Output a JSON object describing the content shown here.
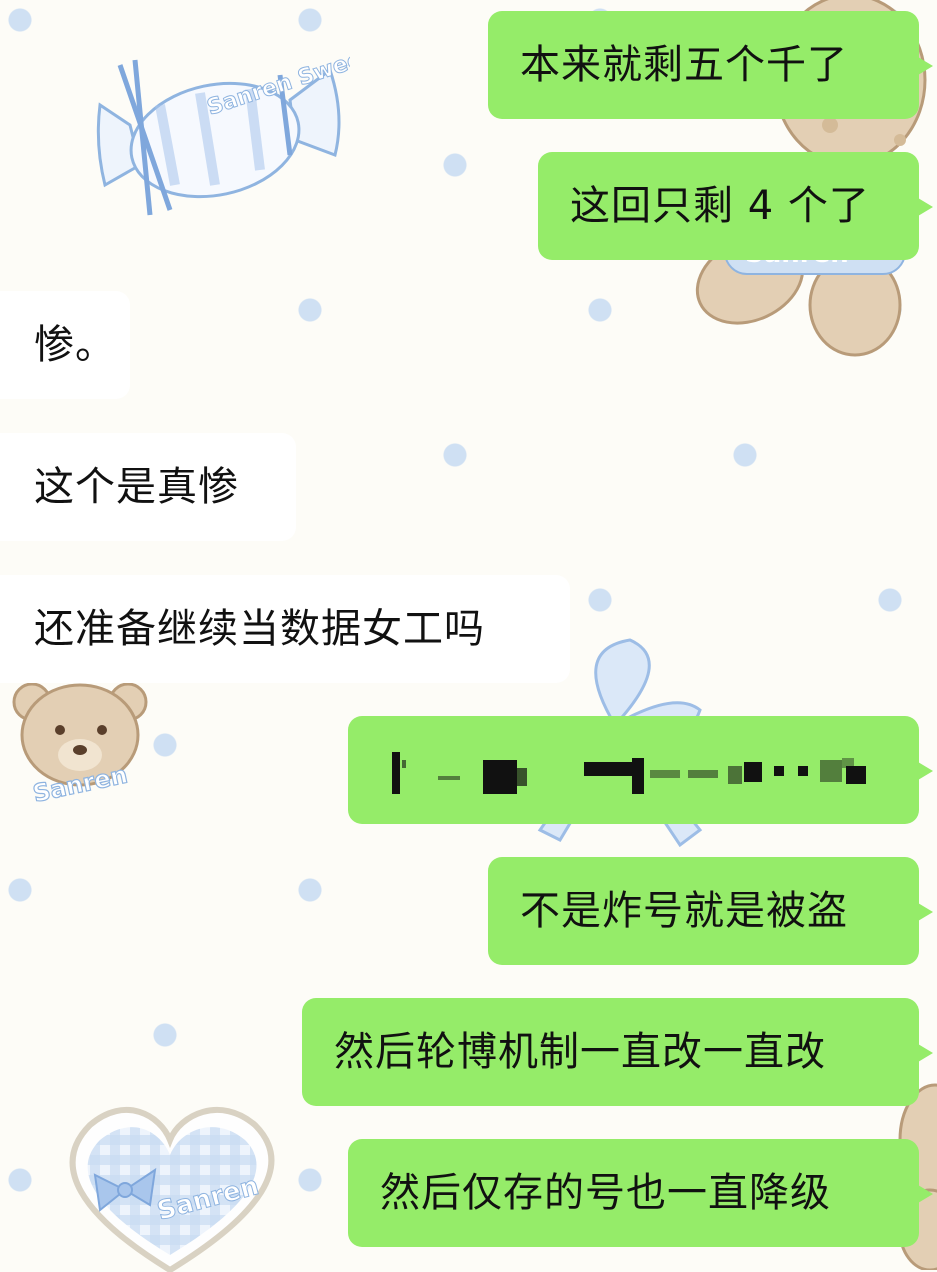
{
  "colors": {
    "outgoing_bubble": "#95ec69",
    "incoming_bubble": "#ffffff",
    "background": "#fdfcf7",
    "dots": "#cfe0f3"
  },
  "stickers": {
    "candy": "Sanren Sweet",
    "bear": "Sanren",
    "heart": "Sanren"
  },
  "messages": [
    {
      "side": "outgoing",
      "text": "本来就剩五个千了"
    },
    {
      "side": "outgoing",
      "text": "这回只剩 4 个了"
    },
    {
      "side": "incoming",
      "text": "惨。"
    },
    {
      "side": "incoming",
      "text": "这个是真惨"
    },
    {
      "side": "incoming",
      "text": "还准备继续当数据女工吗"
    },
    {
      "side": "outgoing",
      "text": "",
      "redacted": true
    },
    {
      "side": "outgoing",
      "text": "不是炸号就是被盗"
    },
    {
      "side": "outgoing",
      "text": "然后轮博机制一直改一直改"
    },
    {
      "side": "outgoing",
      "text": "然后仅存的号也一直降级"
    }
  ]
}
